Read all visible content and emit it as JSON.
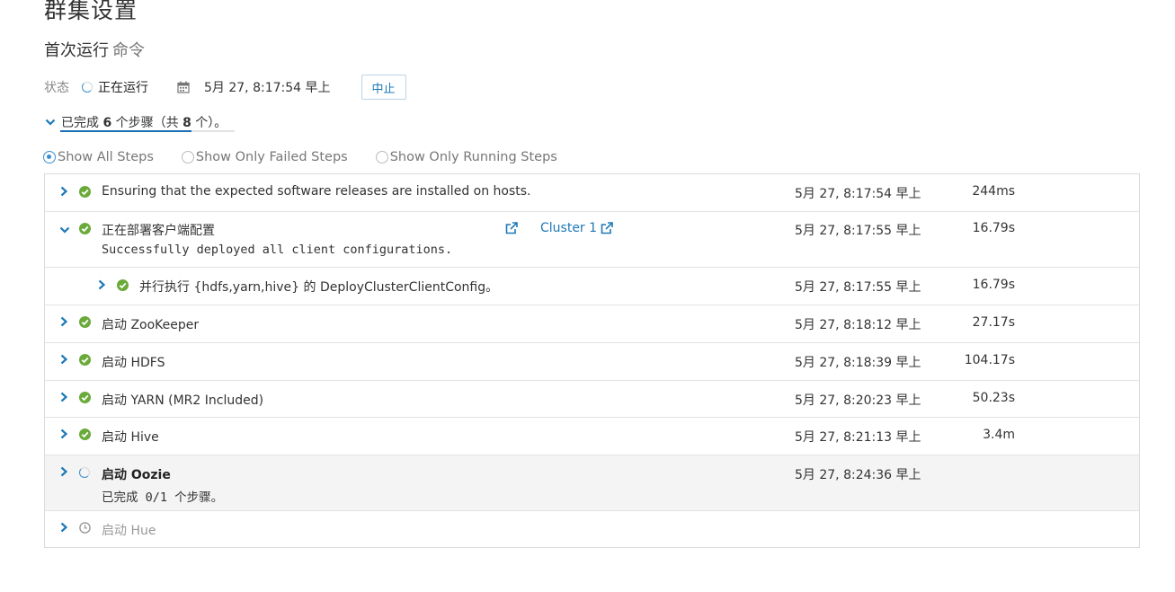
{
  "page_title": "群集设置",
  "subtitle": {
    "main": "首次运行",
    "muted": "命令"
  },
  "status": {
    "label": "状态",
    "value": "正在运行",
    "date": "5月 27, 8:17:54 早上",
    "abort_label": "中止"
  },
  "progress": {
    "prefix": "已完成 ",
    "done": "6",
    "middle": " 个步骤（共 ",
    "total": "8",
    "suffix": " 个）。"
  },
  "filters": [
    {
      "label": "Show All Steps",
      "checked": true
    },
    {
      "label": "Show Only Failed Steps",
      "checked": false
    },
    {
      "label": "Show Only Running Steps",
      "checked": false
    }
  ],
  "steps": [
    {
      "name": "Ensuring that the expected software releases are installed on hosts.",
      "time": "5月 27, 8:17:54 早上",
      "duration": "244ms",
      "state": "done"
    },
    {
      "name": "正在部署客户端配置",
      "detail": "Successfully deployed all client configurations.",
      "link": "Cluster 1",
      "time": "5月 27, 8:17:55 早上",
      "duration": "16.79s",
      "state": "done",
      "expanded": true
    },
    {
      "name": "并行执行 {hdfs,yarn,hive} 的 DeployClusterClientConfig。",
      "time": "5月 27, 8:17:55 早上",
      "duration": "16.79s",
      "state": "done",
      "child": true
    },
    {
      "name": "启动 ZooKeeper",
      "time": "5月 27, 8:18:12 早上",
      "duration": "27.17s",
      "state": "done"
    },
    {
      "name": "启动 HDFS",
      "time": "5月 27, 8:18:39 早上",
      "duration": "104.17s",
      "state": "done"
    },
    {
      "name": "启动 YARN (MR2 Included)",
      "time": "5月 27, 8:20:23 早上",
      "duration": "50.23s",
      "state": "done"
    },
    {
      "name": "启动 Hive",
      "time": "5月 27, 8:21:13 早上",
      "duration": "3.4m",
      "state": "done"
    },
    {
      "name": "启动 Oozie",
      "detail": "已完成 0/1 个步骤。",
      "time": "5月 27, 8:24:36 早上",
      "duration": "",
      "state": "running"
    },
    {
      "name": "启动 Hue",
      "time": "",
      "duration": "",
      "state": "pending"
    }
  ],
  "colors": {
    "accent": "#1d79b8",
    "success": "#6aaa3a",
    "underline": "#1d6fb5"
  },
  "icons": {
    "status": "spinner-icon",
    "date": "calendar-icon",
    "expand": "chevron-right-icon",
    "collapse": "chevron-down-icon",
    "done": "check-circle-icon",
    "pending": "clock-icon",
    "external": "external-link-icon"
  }
}
